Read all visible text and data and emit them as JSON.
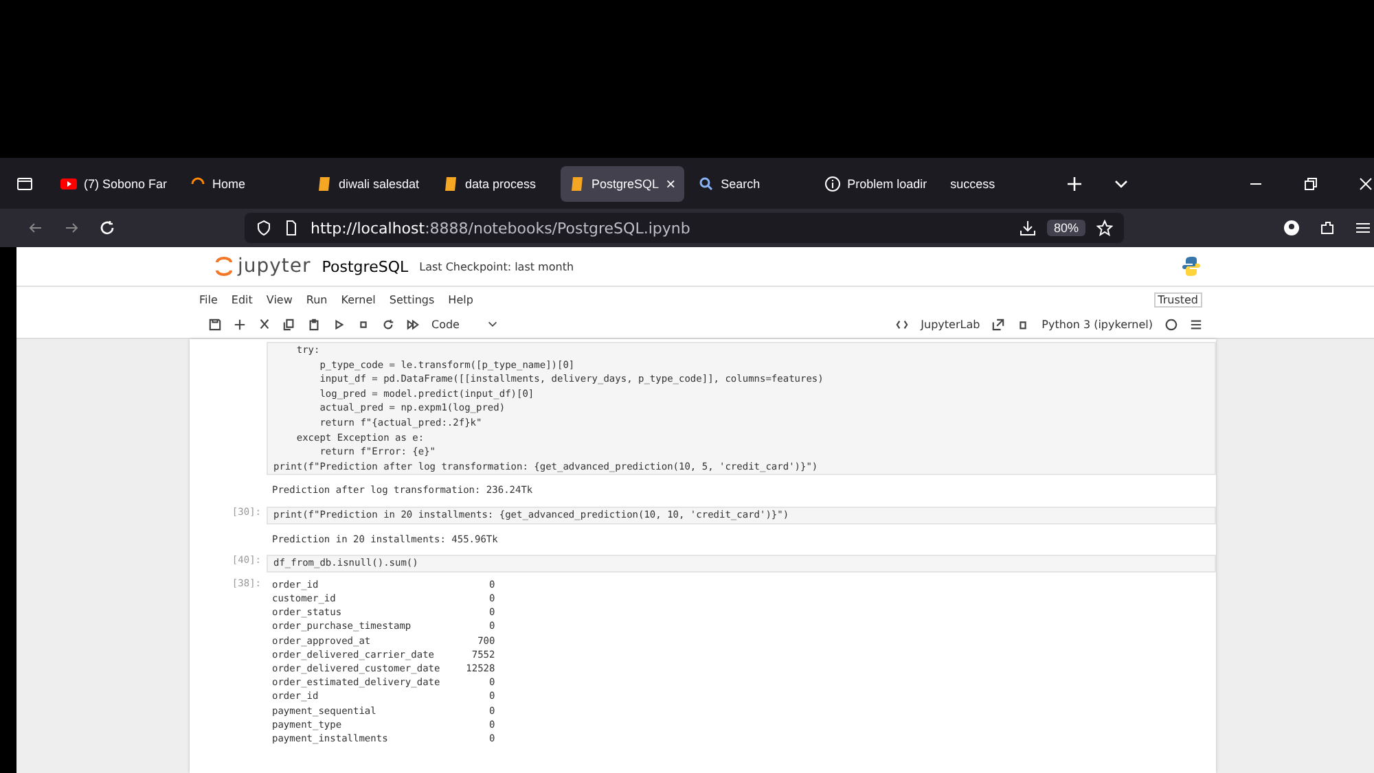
{
  "browser": {
    "tabs": [
      {
        "label": "(7) Sobono Far",
        "kind": "video",
        "selected": false
      },
      {
        "label": "Home",
        "kind": "spinner",
        "selected": false
      },
      {
        "label": "diwali salesdat",
        "kind": "notebook",
        "selected": false
      },
      {
        "label": "data process",
        "kind": "notebook",
        "selected": false
      },
      {
        "label": "PostgreSQL",
        "kind": "notebook",
        "selected": true,
        "close": "×"
      },
      {
        "label": "Search",
        "kind": "search",
        "selected": false
      },
      {
        "label": "Problem loadir",
        "kind": "info",
        "selected": false
      },
      {
        "label": "success",
        "kind": "plain",
        "selected": false
      }
    ],
    "url_host": "http://localhost",
    "url_rest": ":8888/notebooks/PostgreSQL.ipynb",
    "zoom": "80%"
  },
  "jupyter": {
    "logo": "jupyter",
    "title": "PostgreSQL",
    "checkpoint": "Last Checkpoint: last month",
    "menu": [
      "File",
      "Edit",
      "View",
      "Run",
      "Kernel",
      "Settings",
      "Help"
    ],
    "trusted": "Trusted",
    "cell_type": "Code",
    "jupyterlab": "JupyterLab",
    "kernel": "Python 3 (ipykernel)"
  },
  "cells": [
    {
      "code": [
        "    try:",
        "        p_type_code = le.transform([p_type_name])[0]",
        "        input_df = pd.DataFrame([[installments, delivery_days, p_type_code]], columns=features)",
        "        log_pred = model.predict(input_df)[0]",
        "        actual_pred = np.expm1(log_pred)",
        "        return f\"{actual_pred:.2f}k\"",
        "    except Exception as e:",
        "        return f\"Error: {e}\"",
        "print(f\"Prediction after log transformation: {get_advanced_prediction(10, 5, 'credit_card')}\")"
      ],
      "output": [
        "Prediction after log transformation: 236.24Tk"
      ]
    },
    {
      "prompt": "[30]:",
      "code": [
        "print(f\"Prediction in 20 installments: {get_advanced_prediction(10, 10, 'credit_card')}\")"
      ],
      "output": [
        "Prediction in 20 installments: 455.96Tk"
      ]
    },
    {
      "prompt": "[40]:",
      "code": [
        "df_from_db.isnull().sum()"
      ],
      "output_prompt": "[38]:",
      "table": [
        [
          "order_id",
          "0"
        ],
        [
          "customer_id",
          "0"
        ],
        [
          "order_status",
          "0"
        ],
        [
          "order_purchase_timestamp",
          "0"
        ],
        [
          "order_approved_at",
          "700"
        ],
        [
          "order_delivered_carrier_date",
          "7552"
        ],
        [
          "order_delivered_customer_date",
          "12528"
        ],
        [
          "order_estimated_delivery_date",
          "0"
        ],
        [
          "order_id",
          "0"
        ],
        [
          "payment_sequential",
          "0"
        ],
        [
          "payment_type",
          "0"
        ],
        [
          "payment_installments",
          "0"
        ]
      ]
    }
  ]
}
